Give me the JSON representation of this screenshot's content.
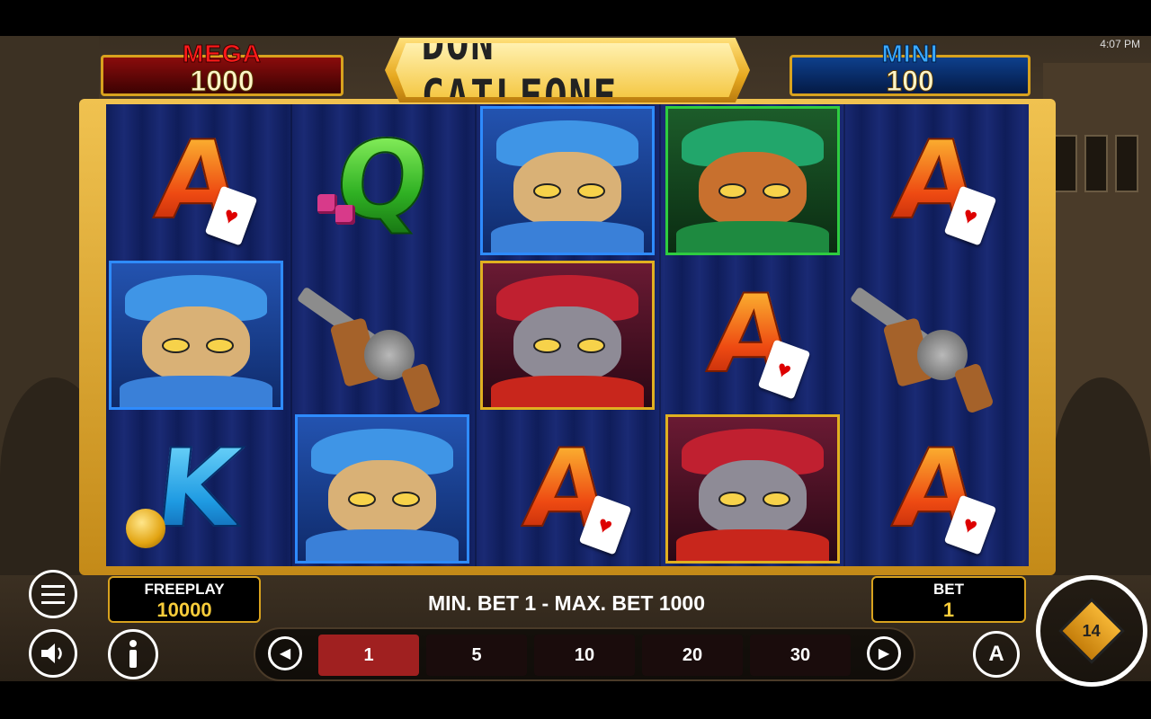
{
  "status_bar": {
    "time": "4:07 PM"
  },
  "game": {
    "title": "DON CATLEONE"
  },
  "jackpots": {
    "mega": {
      "label": "MEGA",
      "value": "1000"
    },
    "mini": {
      "label": "MINI",
      "value": "100"
    }
  },
  "reels": {
    "grid": [
      [
        "A",
        "Q",
        "blue-cat",
        "green-cat",
        "A"
      ],
      [
        "blue-cat",
        "tommy-gun",
        "red-cat",
        "A",
        "tommy-gun"
      ],
      [
        "K",
        "blue-cat",
        "A",
        "red-cat",
        "A"
      ]
    ]
  },
  "balance": {
    "label": "FREEPLAY",
    "value": "10000"
  },
  "bet_limits": "MIN. BET 1 - MAX. BET 1000",
  "bet": {
    "label": "BET",
    "value": "1"
  },
  "bet_chips": {
    "options": [
      "1",
      "5",
      "10",
      "20",
      "30"
    ],
    "selected": "1"
  },
  "spin_button": {
    "badge": "14"
  },
  "autoplay_button": {
    "label": "A"
  },
  "colors": {
    "gold": "#d8a21e",
    "reel_bg": "#13246a",
    "mega_red": "#ff1a1a",
    "mini_blue": "#3aa9ff",
    "selected_chip": "#a02020"
  }
}
